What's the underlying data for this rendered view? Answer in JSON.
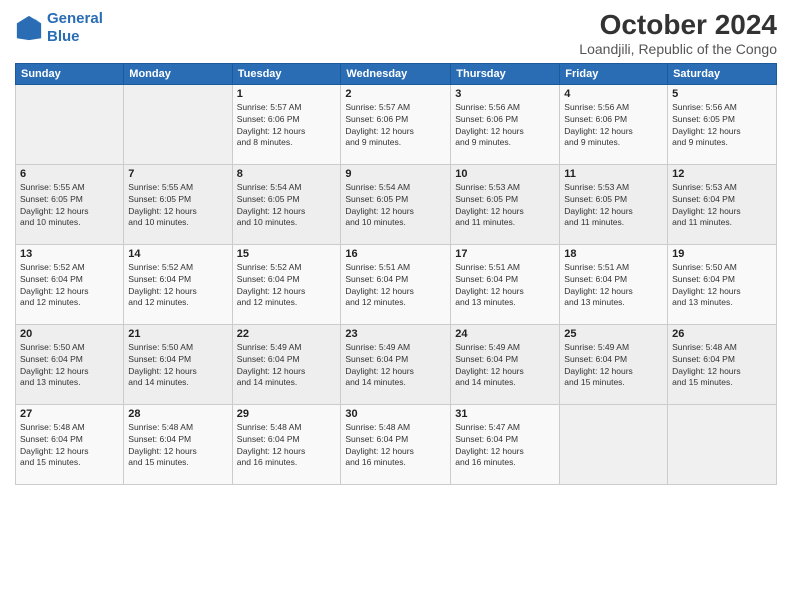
{
  "header": {
    "logo_line1": "General",
    "logo_line2": "Blue",
    "title": "October 2024",
    "subtitle": "Loandjili, Republic of the Congo"
  },
  "days_of_week": [
    "Sunday",
    "Monday",
    "Tuesday",
    "Wednesday",
    "Thursday",
    "Friday",
    "Saturday"
  ],
  "weeks": [
    [
      {
        "day": "",
        "info": ""
      },
      {
        "day": "",
        "info": ""
      },
      {
        "day": "1",
        "info": "Sunrise: 5:57 AM\nSunset: 6:06 PM\nDaylight: 12 hours\nand 8 minutes."
      },
      {
        "day": "2",
        "info": "Sunrise: 5:57 AM\nSunset: 6:06 PM\nDaylight: 12 hours\nand 9 minutes."
      },
      {
        "day": "3",
        "info": "Sunrise: 5:56 AM\nSunset: 6:06 PM\nDaylight: 12 hours\nand 9 minutes."
      },
      {
        "day": "4",
        "info": "Sunrise: 5:56 AM\nSunset: 6:06 PM\nDaylight: 12 hours\nand 9 minutes."
      },
      {
        "day": "5",
        "info": "Sunrise: 5:56 AM\nSunset: 6:05 PM\nDaylight: 12 hours\nand 9 minutes."
      }
    ],
    [
      {
        "day": "6",
        "info": "Sunrise: 5:55 AM\nSunset: 6:05 PM\nDaylight: 12 hours\nand 10 minutes."
      },
      {
        "day": "7",
        "info": "Sunrise: 5:55 AM\nSunset: 6:05 PM\nDaylight: 12 hours\nand 10 minutes."
      },
      {
        "day": "8",
        "info": "Sunrise: 5:54 AM\nSunset: 6:05 PM\nDaylight: 12 hours\nand 10 minutes."
      },
      {
        "day": "9",
        "info": "Sunrise: 5:54 AM\nSunset: 6:05 PM\nDaylight: 12 hours\nand 10 minutes."
      },
      {
        "day": "10",
        "info": "Sunrise: 5:53 AM\nSunset: 6:05 PM\nDaylight: 12 hours\nand 11 minutes."
      },
      {
        "day": "11",
        "info": "Sunrise: 5:53 AM\nSunset: 6:05 PM\nDaylight: 12 hours\nand 11 minutes."
      },
      {
        "day": "12",
        "info": "Sunrise: 5:53 AM\nSunset: 6:04 PM\nDaylight: 12 hours\nand 11 minutes."
      }
    ],
    [
      {
        "day": "13",
        "info": "Sunrise: 5:52 AM\nSunset: 6:04 PM\nDaylight: 12 hours\nand 12 minutes."
      },
      {
        "day": "14",
        "info": "Sunrise: 5:52 AM\nSunset: 6:04 PM\nDaylight: 12 hours\nand 12 minutes."
      },
      {
        "day": "15",
        "info": "Sunrise: 5:52 AM\nSunset: 6:04 PM\nDaylight: 12 hours\nand 12 minutes."
      },
      {
        "day": "16",
        "info": "Sunrise: 5:51 AM\nSunset: 6:04 PM\nDaylight: 12 hours\nand 12 minutes."
      },
      {
        "day": "17",
        "info": "Sunrise: 5:51 AM\nSunset: 6:04 PM\nDaylight: 12 hours\nand 13 minutes."
      },
      {
        "day": "18",
        "info": "Sunrise: 5:51 AM\nSunset: 6:04 PM\nDaylight: 12 hours\nand 13 minutes."
      },
      {
        "day": "19",
        "info": "Sunrise: 5:50 AM\nSunset: 6:04 PM\nDaylight: 12 hours\nand 13 minutes."
      }
    ],
    [
      {
        "day": "20",
        "info": "Sunrise: 5:50 AM\nSunset: 6:04 PM\nDaylight: 12 hours\nand 13 minutes."
      },
      {
        "day": "21",
        "info": "Sunrise: 5:50 AM\nSunset: 6:04 PM\nDaylight: 12 hours\nand 14 minutes."
      },
      {
        "day": "22",
        "info": "Sunrise: 5:49 AM\nSunset: 6:04 PM\nDaylight: 12 hours\nand 14 minutes."
      },
      {
        "day": "23",
        "info": "Sunrise: 5:49 AM\nSunset: 6:04 PM\nDaylight: 12 hours\nand 14 minutes."
      },
      {
        "day": "24",
        "info": "Sunrise: 5:49 AM\nSunset: 6:04 PM\nDaylight: 12 hours\nand 14 minutes."
      },
      {
        "day": "25",
        "info": "Sunrise: 5:49 AM\nSunset: 6:04 PM\nDaylight: 12 hours\nand 15 minutes."
      },
      {
        "day": "26",
        "info": "Sunrise: 5:48 AM\nSunset: 6:04 PM\nDaylight: 12 hours\nand 15 minutes."
      }
    ],
    [
      {
        "day": "27",
        "info": "Sunrise: 5:48 AM\nSunset: 6:04 PM\nDaylight: 12 hours\nand 15 minutes."
      },
      {
        "day": "28",
        "info": "Sunrise: 5:48 AM\nSunset: 6:04 PM\nDaylight: 12 hours\nand 15 minutes."
      },
      {
        "day": "29",
        "info": "Sunrise: 5:48 AM\nSunset: 6:04 PM\nDaylight: 12 hours\nand 16 minutes."
      },
      {
        "day": "30",
        "info": "Sunrise: 5:48 AM\nSunset: 6:04 PM\nDaylight: 12 hours\nand 16 minutes."
      },
      {
        "day": "31",
        "info": "Sunrise: 5:47 AM\nSunset: 6:04 PM\nDaylight: 12 hours\nand 16 minutes."
      },
      {
        "day": "",
        "info": ""
      },
      {
        "day": "",
        "info": ""
      }
    ]
  ]
}
